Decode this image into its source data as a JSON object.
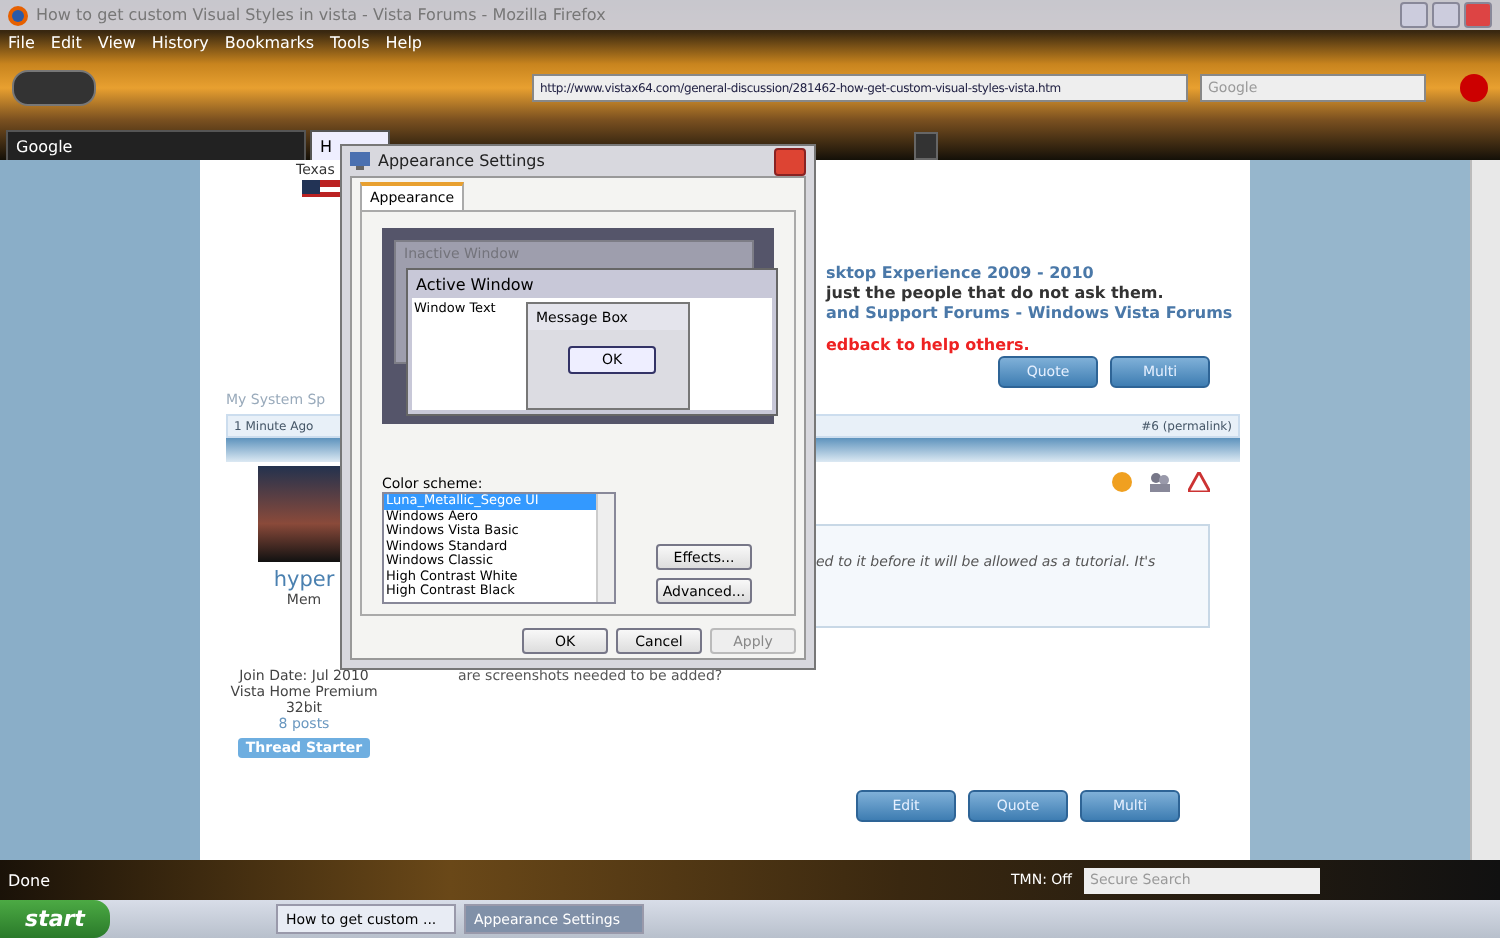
{
  "browser": {
    "title": "How to get custom Visual Styles in vista - Vista Forums - Mozilla Firefox",
    "menu": [
      "File",
      "Edit",
      "View",
      "History",
      "Bookmarks",
      "Tools",
      "Help"
    ],
    "address": "http://www.vistax64.com/general-discussion/281462-how-get-custom-visual-styles-vista.htm",
    "search_placeholder": "Google",
    "tabs": [
      {
        "label": "Google",
        "selected": false
      },
      {
        "label": "H",
        "selected": true
      }
    ],
    "status": "Done",
    "addon": "TMN: Off",
    "secure_search_placeholder": "Secure Search"
  },
  "page": {
    "location": "Texas",
    "signature": [
      {
        "text": "sktop Experience 2009 - 2010",
        "kind": "link"
      },
      {
        "text": "just the people that do not ask them.",
        "kind": "plain"
      },
      {
        "text": "and Support Forums - Windows Vista Forums",
        "kind": "link"
      },
      {
        "text": "edback to help others.",
        "kind": "alert"
      }
    ],
    "post_buttons_1": [
      "Quote",
      "Multi"
    ],
    "system_spec": "My System Sp",
    "post_time": "1 Minute Ago",
    "permalink": "#6 (permalink)",
    "username": "hyper",
    "user_title": "Mem",
    "join_date": "Join Date: Jul 2010",
    "os": "Vista Home Premium 32bit",
    "posts": "8 posts",
    "badge": "Thread Starter",
    "quote": "ed to it before it will be allowed as a tutorial. It's",
    "message": "are screenshots needed to be added?",
    "post_buttons_2": [
      "Edit",
      "Quote",
      "Multi"
    ]
  },
  "dialog": {
    "title": "Appearance Settings",
    "tabs": [
      {
        "label": "Appearance",
        "selected": true
      }
    ],
    "preview": {
      "inactive_title": "Inactive Window",
      "active_title": "Active Window",
      "window_text": "Window Text",
      "message_title": "Message Box",
      "message_button": "OK"
    },
    "scheme_label": "Color scheme:",
    "schemes": [
      {
        "label": "Luna_Metallic_Segoe UI",
        "selected": true
      },
      {
        "label": "Windows Aero",
        "selected": false
      },
      {
        "label": "Windows Vista Basic",
        "selected": false
      },
      {
        "label": "Windows Standard",
        "selected": false
      },
      {
        "label": "Windows Classic",
        "selected": false
      },
      {
        "label": "High Contrast White",
        "selected": false
      },
      {
        "label": "High Contrast Black",
        "selected": false
      }
    ],
    "side_buttons": [
      "Effects...",
      "Advanced..."
    ],
    "footer": [
      {
        "label": "OK",
        "disabled": false
      },
      {
        "label": "Cancel",
        "disabled": false
      },
      {
        "label": "Apply",
        "disabled": true
      }
    ]
  },
  "taskbar": {
    "start": "start",
    "windows": [
      {
        "label": "How to get custom ...",
        "selected": false
      },
      {
        "label": "Appearance Settings",
        "selected": true
      }
    ]
  }
}
